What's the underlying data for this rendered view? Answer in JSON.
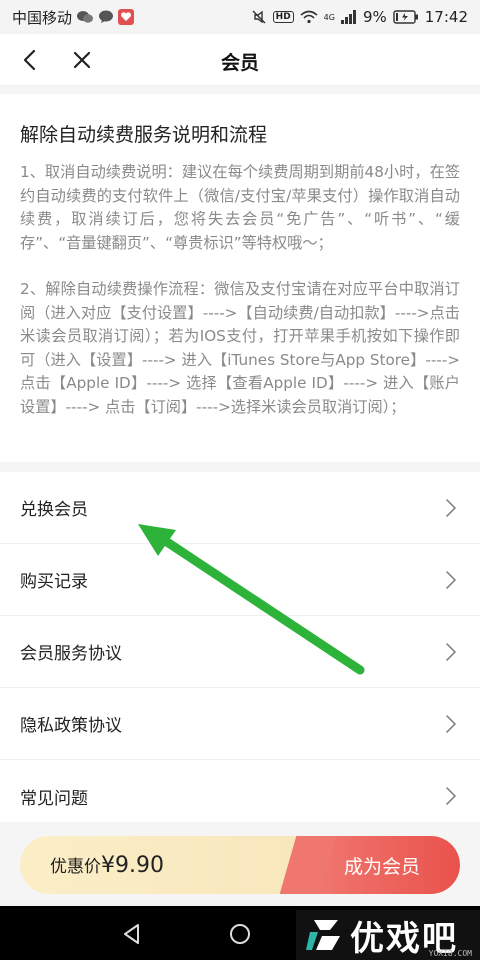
{
  "status_bar": {
    "carrier": "中国移动",
    "network": "4G",
    "battery": "9%",
    "time": "17:42",
    "hd_badge": "HD",
    "icons": [
      "wechat-icon",
      "chat-bubble-icon",
      "app-badge-icon",
      "mute-icon",
      "wifi-icon",
      "signal-icon",
      "battery-icon"
    ]
  },
  "header": {
    "title": "会员",
    "back_icon": "chevron-left-icon",
    "close_icon": "close-icon"
  },
  "info": {
    "title": "解除自动续费服务说明和流程",
    "para1": "1、取消自动续费说明：建议在每个续费周期到期前48小时，在签约自动续费的支付软件上（微信/支付宝/苹果支付）操作取消自动续费，取消续订后，您将失去会员“免广告”、“听书”、“缓存”、“音量键翻页”、“尊贵标识”等特权哦～；",
    "para2": "2、解除自动续费操作流程：微信及支付宝请在对应平台中取消订阅（进入对应【支付设置】---->【自动续费/自动扣款】---->点击米读会员取消订阅）；若为IOS支付，打开苹果手机按如下操作即可（进入【设置】----> 进入【iTunes Store与App Store】----> 点击【Apple ID】----> 选择【查看Apple ID】----> 进入【账户设置】----> 点击【订阅】---->选择米读会员取消订阅）；"
  },
  "menu": {
    "items": [
      {
        "label": "兑换会员"
      },
      {
        "label": "购买记录"
      },
      {
        "label": "会员服务协议"
      },
      {
        "label": "隐私政策协议"
      },
      {
        "label": "常见问题"
      }
    ]
  },
  "purchase": {
    "price_label": "优惠价",
    "price_value": "¥9.90",
    "cta_label": "成为会员"
  },
  "watermark": {
    "text": "优戏吧",
    "sub": "YOXI8.COM"
  },
  "colors": {
    "accent": "#e9524c",
    "price_bg": "#fbeec6",
    "annotation_arrow": "#2db23a"
  }
}
